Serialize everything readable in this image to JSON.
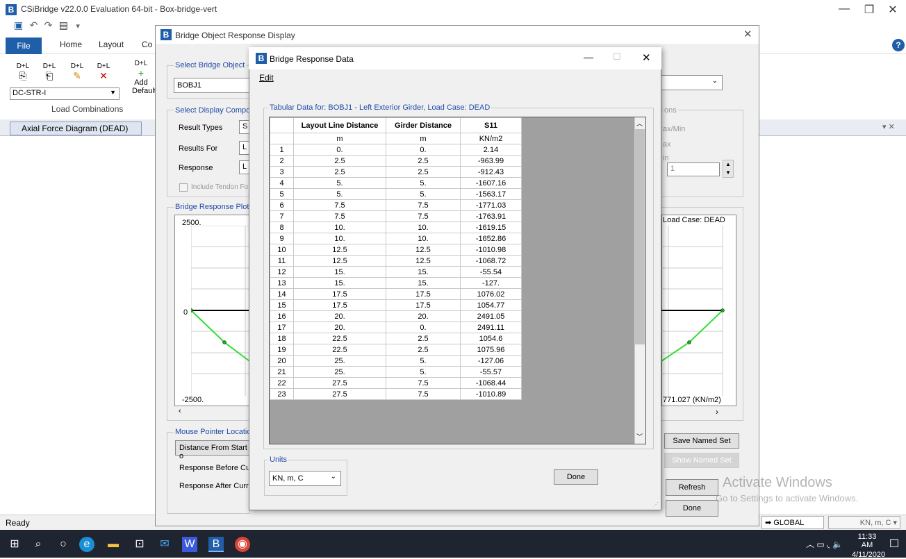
{
  "app": {
    "title": "CSiBridge v22.0.0 Evaluation 64-bit - Box-bridge-vert",
    "ribbon_tabs": [
      "File",
      "Home",
      "Layout",
      "Co"
    ],
    "dpl_buttons": [
      "D+L",
      "D+L",
      "D+L",
      "D+L",
      "D+L"
    ],
    "add_label": "Add",
    "default_label": "Default",
    "combo_value": "DC-STR-I",
    "load_combinations_label": "Load Combinations",
    "view_tab": "Axial Force Diagram (DEAD)",
    "status": "Ready",
    "coord_system": "GLOBAL",
    "units_status": "KN, m, C"
  },
  "dialog_response_display": {
    "title": "Bridge Object Response Display",
    "select_bridge_object_label": "Select Bridge Object",
    "bridge_object": "BOBJ1",
    "select_display_label": "Select Display Compone",
    "result_types_label": "Result Types",
    "result_types_value": "S",
    "results_for_label": "Results For",
    "results_for_value": "L",
    "response_label": "Response",
    "response_value": "L",
    "include_tendon_label": "Include Tendon Fo",
    "plot_group_label": "Bridge Response Plot",
    "plot_top": "2500.",
    "plot_zero": "0",
    "plot_bottom": "-2500.",
    "mouse_pointer_label": "Mouse Pointer Location",
    "distance_label": "Distance From Start o",
    "response_before_label": "Response Before Cur",
    "response_after_label": "Response After Curre",
    "right_ons": "ons",
    "right_maxmin": "ax/Min",
    "right_max": "ax",
    "right_in": "in",
    "right_spin_value": "1",
    "right_loadcase": "Load Case: DEAD",
    "right_value": "771.027  (KN/m2)",
    "save_named_set": "Save Named Set",
    "show_named_set": "Show Named Set",
    "refresh": "Refresh",
    "done": "Done"
  },
  "dialog_response_data": {
    "title": "Bridge Response Data",
    "menu_edit": "Edit",
    "tabular_label": "Tabular Data for:  BOBJ1 - Left Exterior Girder,  Load Case: DEAD",
    "headers": [
      "Layout Line Distance",
      "Girder Distance",
      "S11"
    ],
    "units": [
      "m",
      "m",
      "KN/m2"
    ],
    "rows": [
      [
        "1",
        "0.",
        "0.",
        "2.14"
      ],
      [
        "2",
        "2.5",
        "2.5",
        "-963.99"
      ],
      [
        "3",
        "2.5",
        "2.5",
        "-912.43"
      ],
      [
        "4",
        "5.",
        "5.",
        "-1607.16"
      ],
      [
        "5",
        "5.",
        "5.",
        "-1563.17"
      ],
      [
        "6",
        "7.5",
        "7.5",
        "-1771.03"
      ],
      [
        "7",
        "7.5",
        "7.5",
        "-1763.91"
      ],
      [
        "8",
        "10.",
        "10.",
        "-1619.15"
      ],
      [
        "9",
        "10.",
        "10.",
        "-1652.86"
      ],
      [
        "10",
        "12.5",
        "12.5",
        "-1010.98"
      ],
      [
        "11",
        "12.5",
        "12.5",
        "-1068.72"
      ],
      [
        "12",
        "15.",
        "15.",
        "-55.54"
      ],
      [
        "13",
        "15.",
        "15.",
        "-127."
      ],
      [
        "14",
        "17.5",
        "17.5",
        "1076.02"
      ],
      [
        "15",
        "17.5",
        "17.5",
        "1054.77"
      ],
      [
        "16",
        "20.",
        "20.",
        "2491.05"
      ],
      [
        "17",
        "20.",
        "0.",
        "2491.11"
      ],
      [
        "18",
        "22.5",
        "2.5",
        "1054.6"
      ],
      [
        "19",
        "22.5",
        "2.5",
        "1075.96"
      ],
      [
        "20",
        "25.",
        "5.",
        "-127.06"
      ],
      [
        "21",
        "25.",
        "5.",
        "-55.57"
      ],
      [
        "22",
        "27.5",
        "7.5",
        "-1068.44"
      ],
      [
        "23",
        "27.5",
        "7.5",
        "-1010.89"
      ]
    ],
    "units_group_label": "Units",
    "units_value": "KN, m, C",
    "done": "Done"
  },
  "watermark": {
    "line1": "Activate Windows",
    "line2": "Go to Settings to activate Windows."
  },
  "taskbar": {
    "time": "11:33 AM",
    "date": "4/11/2020"
  },
  "colors": {
    "accent": "#1f5ea8",
    "plot_line": "#33dd33"
  }
}
